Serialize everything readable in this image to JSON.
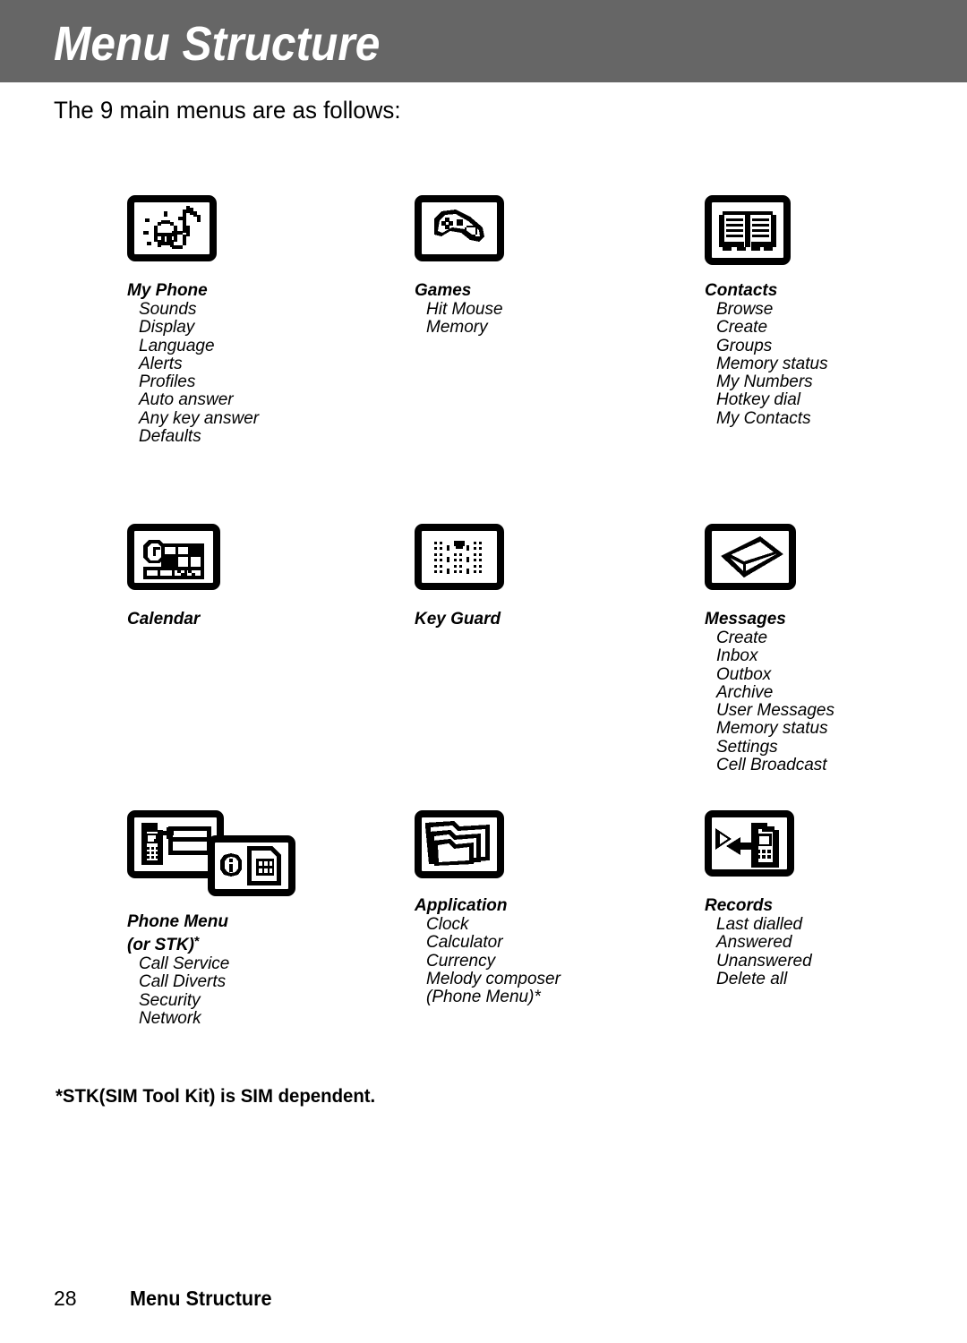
{
  "header": {
    "title": "Menu Structure",
    "band_color": "#666666",
    "text_color": "#ffffff"
  },
  "intro": {
    "text": "The 9 main menus are as follows:"
  },
  "menus": [
    {
      "icon_name": "my-phone-icon",
      "title": "My Phone",
      "title2": "",
      "items": [
        "Sounds",
        "Display",
        "Language",
        "Alerts",
        "Profiles",
        "Auto answer",
        "Any key answer",
        "Defaults"
      ]
    },
    {
      "icon_name": "games-gamepad-icon",
      "title": "Games",
      "title2": "",
      "items": [
        "Hit Mouse",
        "Memory"
      ]
    },
    {
      "icon_name": "contacts-book-icon",
      "title": "Contacts",
      "title2": "",
      "items": [
        "Browse",
        "Create",
        "Groups",
        "Memory status",
        "My Numbers",
        "Hotkey dial",
        "My Contacts"
      ]
    },
    {
      "icon_name": "calendar-icon",
      "title": "Calendar",
      "title2": "",
      "items": []
    },
    {
      "icon_name": "key-guard-icon",
      "title": "Key Guard",
      "title2": "",
      "items": []
    },
    {
      "icon_name": "messages-envelope-icon",
      "title": "Messages",
      "title2": "",
      "items": [
        "Create",
        "Inbox",
        "Outbox",
        "Archive",
        "User Messages",
        "Memory status",
        "Settings",
        "Cell Broadcast"
      ]
    },
    {
      "icon_name": "phone-menu-stk-icon",
      "title": "Phone Menu",
      "title2": "(or STK)",
      "title2_star": "*",
      "items": [
        "Call Service",
        "Call Diverts",
        "Security",
        "Network"
      ]
    },
    {
      "icon_name": "application-folders-icon",
      "title": "Application",
      "title2": "",
      "items": [
        "Clock",
        "Calculator",
        "Currency",
        "Melody composer",
        "(Phone Menu)*"
      ]
    },
    {
      "icon_name": "records-calls-icon",
      "title": "Records",
      "title2": "",
      "items": [
        "Last dialled",
        "Answered",
        "Unanswered",
        "Delete all"
      ]
    }
  ],
  "footnote": {
    "text": "*STK(SIM Tool Kit) is SIM dependent."
  },
  "footer": {
    "page_number": "28",
    "title": "Menu Structure"
  }
}
